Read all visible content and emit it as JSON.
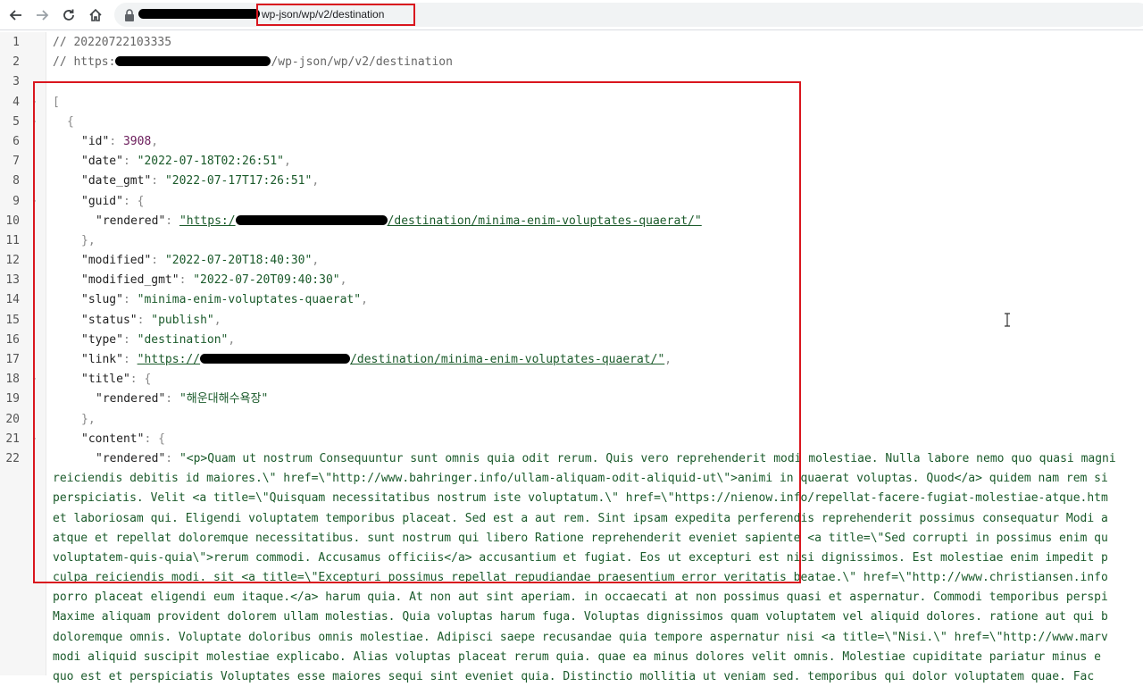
{
  "browser": {
    "url_path": "wp-json/wp/v2/destination",
    "back_icon": "arrow-left-icon",
    "forward_icon": "arrow-right-icon",
    "reload_icon": "reload-icon",
    "home_icon": "home-icon",
    "lock_icon": "lock-icon"
  },
  "lines": {
    "l1": "// 20220722103335",
    "l2_prefix": "// https:",
    "l2_suffix": "/wp-json/wp/v2/destination",
    "l4": "[",
    "l5": "{",
    "id_key": "\"id\"",
    "id_val": "3908",
    "date_key": "\"date\"",
    "date_val": "\"2022-07-18T02:26:51\"",
    "date_gmt_key": "\"date_gmt\"",
    "date_gmt_val": "\"2022-07-17T17:26:51\"",
    "guid_key": "\"guid\"",
    "rendered_key": "\"rendered\"",
    "guid_val_prefix": "\"https:/",
    "guid_val_suffix": "/destination/minima-enim-voluptates-quaerat/\"",
    "close_brace": "},",
    "modified_key": "\"modified\"",
    "modified_val": "\"2022-07-20T18:40:30\"",
    "modified_gmt_key": "\"modified_gmt\"",
    "modified_gmt_val": "\"2022-07-20T09:40:30\"",
    "slug_key": "\"slug\"",
    "slug_val": "\"minima-enim-voluptates-quaerat\"",
    "status_key": "\"status\"",
    "status_val": "\"publish\"",
    "type_key": "\"type\"",
    "type_val": "\"destination\"",
    "link_key": "\"link\"",
    "link_val_prefix": "\"https://",
    "link_val_suffix": "/destination/minima-enim-voluptates-quaerat/\"",
    "title_key": "\"title\"",
    "title_val": "\"해운대해수욕장\"",
    "content_key": "\"content\"",
    "content_first": "\"<p>Quam ut nostrum Consequuntur sunt omnis quia odit rerum. Quis vero reprehenderit modi molestiae. Nulla labore nemo quo quasi magni",
    "content_wrap": [
      "reiciendis debitis id maiores.\\\" href=\\\"http://www.bahringer.info/ullam-aliquam-odit-aliquid-ut\\\">animi in quaerat voluptas. Quod</a> quidem nam rem si",
      "perspiciatis. Velit <a title=\\\"Quisquam necessitatibus nostrum iste voluptatum.\\\" href=\\\"https://nienow.info/repellat-facere-fugiat-molestiae-atque.htm",
      "et laboriosam qui. Eligendi voluptatem temporibus placeat. Sed est a aut rem. Sint ipsam expedita perferendis reprehenderit possimus consequatur Modi a",
      "atque et repellat doloremque necessitatibus. sunt nostrum qui libero Ratione reprehenderit eveniet sapiente <a title=\\\"Sed corrupti in possimus enim qu",
      "voluptatem-quis-quia\\\">rerum commodi. Accusamus officiis</a> accusantium et fugiat. Eos ut excepturi est nisi dignissimos. Est molestiae enim impedit p",
      "culpa reiciendis modi. sit <a title=\\\"Excepturi possimus repellat repudiandae praesentium error veritatis beatae.\\\" href=\\\"http://www.christiansen.info",
      "porro placeat eligendi eum itaque.</a> harum quia. At non aut sint aperiam. in occaecati at non possimus quasi et aspernatur. Commodi temporibus perspi",
      "Maxime aliquam provident dolorem ullam molestias. Quia voluptas harum fuga. Voluptas dignissimos quam voluptatem vel aliquid dolores. ratione aut qui b",
      "doloremque omnis. Voluptate doloribus omnis molestiae. Adipisci saepe recusandae quia tempore aspernatur nisi <a title=\\\"Nisi.\\\" href=\\\"http://www.marv",
      "modi aliquid suscipit molestiae explicabo. Alias voluptas placeat rerum quia. quae ea minus dolores velit omnis. Molestiae cupiditate pariatur minus e",
      "quo est et perspiciatis Voluptates esse maiores sequi sint eveniet quia. Distinctio mollitia ut veniam sed. temporibus qui dolor voluptatem quae. Fac"
    ]
  },
  "line_numbers": [
    "1",
    "2",
    "3",
    "4",
    "5",
    "6",
    "7",
    "8",
    "9",
    "10",
    "11",
    "12",
    "13",
    "14",
    "15",
    "16",
    "17",
    "18",
    "19",
    "20",
    "21",
    "22"
  ]
}
